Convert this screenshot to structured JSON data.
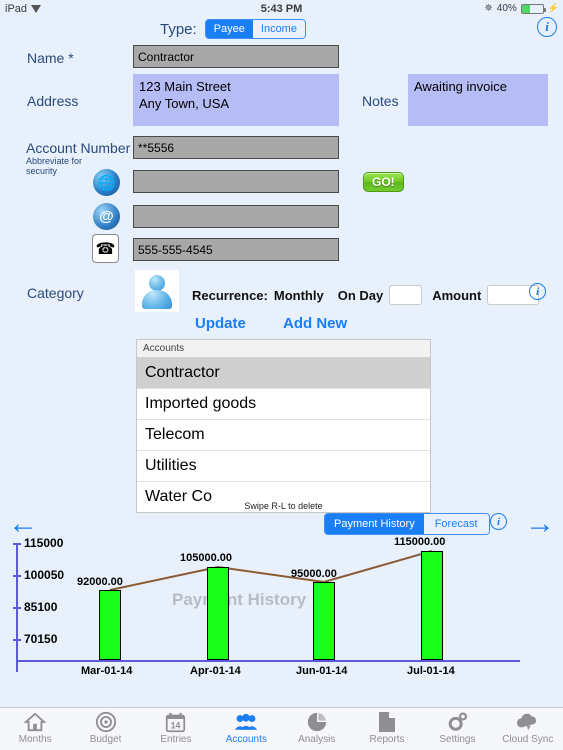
{
  "statusbar": {
    "device": "iPad",
    "wifi_icon": "wifi-icon",
    "time": "5:43 PM",
    "bluetooth_icon": "bluetooth-icon",
    "battery_percent": "40%",
    "battery_level": 40
  },
  "header": {
    "type_label": "Type:",
    "segments": [
      {
        "label": "Payee",
        "selected": true
      },
      {
        "label": "Income",
        "selected": false
      }
    ],
    "info_icon": "info-icon"
  },
  "form": {
    "name": {
      "label": "Name *",
      "value": "Contractor"
    },
    "address": {
      "label": "Address",
      "value": "123 Main Street\nAny Town, USA"
    },
    "notes": {
      "label": "Notes",
      "value": "Awaiting invoice"
    },
    "account_number": {
      "label": "Account Number",
      "sublabel": "Abbreviate for\nsecurity",
      "value": "**5556"
    },
    "website": {
      "icon": "globe-icon",
      "value": "",
      "go_label": "GO!"
    },
    "email": {
      "icon": "at-icon",
      "value": ""
    },
    "phone": {
      "icon": "phone-icon",
      "value": "555-555-4545"
    },
    "category": {
      "label": "Category",
      "icon": "person-icon"
    },
    "recurrence": {
      "label": "Recurrence:",
      "value": "Monthly"
    },
    "on_day": {
      "label": "On Day",
      "value": ""
    },
    "amount": {
      "label": "Amount",
      "value": ""
    },
    "info_icon": "info-icon",
    "update_label": "Update",
    "add_new_label": "Add New"
  },
  "accounts": {
    "header": "Accounts",
    "rows": [
      {
        "name": "Contractor",
        "selected": true
      },
      {
        "name": "Imported goods",
        "selected": false
      },
      {
        "name": "Telecom",
        "selected": false
      },
      {
        "name": "Utilities",
        "selected": false
      },
      {
        "name": "Water Co",
        "selected": false
      }
    ],
    "hint": "Swipe R-L to delete"
  },
  "chart_toolbar": {
    "prev_icon": "left-arrow-icon",
    "next_icon": "right-arrow-icon",
    "segments": [
      {
        "label": "Payment History",
        "selected": true
      },
      {
        "label": "Forecast",
        "selected": false
      }
    ],
    "info_icon": "info-icon"
  },
  "chart_data": {
    "type": "bar",
    "title": "Payment History",
    "xlabel": "",
    "ylabel": "",
    "categories": [
      "Mar-01-14",
      "Apr-01-14",
      "Jun-01-14",
      "Jul-01-14"
    ],
    "values": [
      92000.0,
      105000.0,
      95000.0,
      115000.0
    ],
    "value_labels": [
      "92000.00",
      "105000.00",
      "95000.00",
      "115000.00"
    ],
    "yticks": [
      "115000",
      "100050",
      "85100",
      "70150"
    ],
    "ytick_values": [
      115000,
      100050,
      85100,
      70150
    ],
    "ylim": [
      55200,
      115000
    ],
    "grid": false,
    "legend": "none",
    "series": [
      {
        "name": "Payment History bars",
        "type": "bar",
        "color": "#1aff1a",
        "values": [
          92000.0,
          105000.0,
          95000.0,
          115000.0
        ]
      },
      {
        "name": "Trend line",
        "type": "line",
        "color": "#8a5a33",
        "values": [
          92000.0,
          105000.0,
          95000.0,
          115000.0
        ]
      }
    ]
  },
  "tabbar": {
    "items": [
      {
        "label": "Months",
        "icon": "home-icon",
        "active": false
      },
      {
        "label": "Budget",
        "icon": "target-icon",
        "active": false
      },
      {
        "label": "Entries",
        "icon": "calendar-icon",
        "active": false
      },
      {
        "label": "Accounts",
        "icon": "people-icon",
        "active": true
      },
      {
        "label": "Analysis",
        "icon": "piechart-icon",
        "active": false
      },
      {
        "label": "Reports",
        "icon": "document-icon",
        "active": false
      },
      {
        "label": "Settings",
        "icon": "gears-icon",
        "active": false
      },
      {
        "label": "Cloud Sync",
        "icon": "cloud-icon",
        "active": false
      }
    ]
  },
  "colors": {
    "accent": "#1a7ef5",
    "background": "#e8f0fb",
    "bar": "#1aff1a",
    "line": "#8a5a33",
    "field_gray": "#a8a8a8",
    "field_lavender": "#b6bdf6"
  }
}
